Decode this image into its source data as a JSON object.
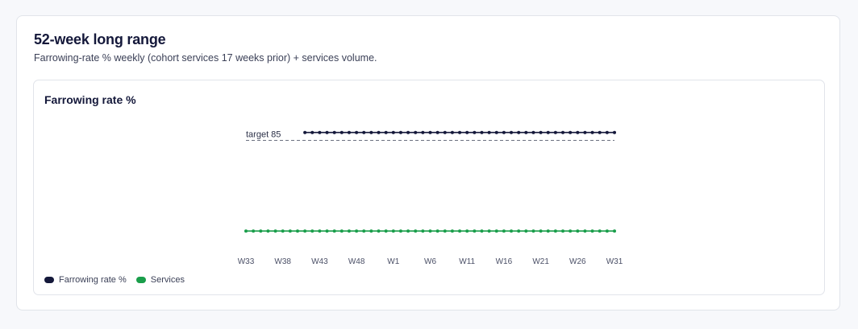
{
  "header": {
    "title": "52-week long range",
    "subtitle": "Farrowing-rate % weekly (cohort services 17 weeks prior) + services volume."
  },
  "chart": {
    "title": "Farrowing rate %",
    "target_label": "target 85"
  },
  "colors": {
    "farrowing": "#14183a",
    "services": "#1a9e4b",
    "target_line": "#6b7080"
  },
  "chart_data": {
    "type": "line",
    "title": "Farrowing rate %",
    "x": [
      "W33",
      "W34",
      "W35",
      "W36",
      "W37",
      "W38",
      "W39",
      "W40",
      "W41",
      "W42",
      "W43",
      "W44",
      "W45",
      "W46",
      "W47",
      "W48",
      "W49",
      "W50",
      "W51",
      "W52",
      "W1",
      "W2",
      "W3",
      "W4",
      "W5",
      "W6",
      "W7",
      "W8",
      "W9",
      "W10",
      "W11",
      "W12",
      "W13",
      "W14",
      "W15",
      "W16",
      "W17",
      "W18",
      "W19",
      "W20",
      "W21",
      "W22",
      "W23",
      "W24",
      "W25",
      "W26",
      "W27",
      "W28",
      "W29",
      "W30",
      "W31"
    ],
    "x_tick_labels": [
      "W33",
      "W38",
      "W43",
      "W48",
      "W1",
      "W6",
      "W11",
      "W16",
      "W21",
      "W26",
      "W31"
    ],
    "target": {
      "value": 85,
      "label": "target 85"
    },
    "series": [
      {
        "name": "Farrowing rate %",
        "values": [
          null,
          null,
          null,
          null,
          null,
          null,
          null,
          null,
          87,
          87,
          87,
          87,
          87,
          87,
          87,
          87,
          87,
          87,
          87,
          87,
          87,
          87,
          87,
          87,
          87,
          87,
          87,
          87,
          87,
          87,
          87,
          87,
          87,
          87,
          87,
          87,
          87,
          87,
          87,
          87,
          87,
          87,
          87,
          87,
          87,
          87,
          87,
          87,
          87,
          87,
          87
        ]
      },
      {
        "name": "Services",
        "values": [
          62,
          62,
          62,
          62,
          62,
          62,
          62,
          62,
          62,
          62,
          62,
          62,
          62,
          62,
          62,
          62,
          62,
          62,
          62,
          62,
          62,
          62,
          62,
          62,
          62,
          62,
          62,
          62,
          62,
          62,
          62,
          62,
          62,
          62,
          62,
          62,
          62,
          62,
          62,
          62,
          62,
          62,
          62,
          62,
          62,
          62,
          62,
          62,
          62,
          62,
          62
        ]
      }
    ],
    "ylim": [
      60,
      90
    ],
    "grid": false,
    "legend": "bottom-left"
  },
  "legend": [
    {
      "label": "Farrowing rate %",
      "color": "#14183a"
    },
    {
      "label": "Services",
      "color": "#1a9e4b"
    }
  ]
}
